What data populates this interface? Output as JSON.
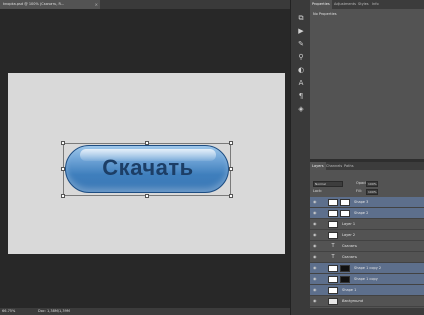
{
  "document_tab": {
    "title": "knopka.psd @ 100% (Скачать, R...",
    "close": "×"
  },
  "canvas": {
    "button_label": "Скачать"
  },
  "status": {
    "zoom": "66.75%",
    "doc_info": "Doc: 1,38M/1,39M"
  },
  "toolstrip": {
    "icons": [
      "history-icon",
      "actions-icon",
      "brush-icon",
      "clone-icon",
      "adjust-icon",
      "type-icon",
      "paragraph-icon",
      "3d-icon"
    ]
  },
  "properties_panel": {
    "tabs": [
      "Properties",
      "Adjustments",
      "Styles",
      "Info"
    ],
    "title": "No Properties"
  },
  "layers_panel": {
    "tabs": [
      "Layers",
      "Channels",
      "Paths"
    ],
    "blend_mode": "Normal",
    "opacity_label": "Opacity:",
    "opacity_value": "100%",
    "lock_label": "Lock:",
    "fill_label": "Fill:",
    "fill_value": "100%",
    "layers": [
      {
        "name": "Shape 3",
        "selected": true
      },
      {
        "name": "Shape 2",
        "selected": true
      },
      {
        "name": "Layer 1",
        "selected": false
      },
      {
        "name": "Layer 2",
        "selected": false
      },
      {
        "name": "Скачать",
        "selected": false
      },
      {
        "name": "Скачать",
        "selected": false
      },
      {
        "name": "Shape 1 copy 2",
        "selected": true
      },
      {
        "name": "Shape 1 copy",
        "selected": true
      },
      {
        "name": "Shape 1",
        "selected": true
      },
      {
        "name": "Background",
        "selected": false
      }
    ]
  }
}
